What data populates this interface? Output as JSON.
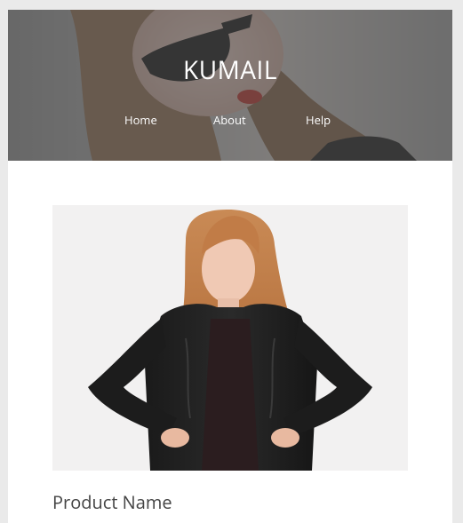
{
  "header": {
    "brand": "KUMAIL",
    "nav": [
      {
        "label": "Home"
      },
      {
        "label": "About"
      },
      {
        "label": "Help"
      }
    ]
  },
  "product": {
    "name": "Product Name"
  }
}
